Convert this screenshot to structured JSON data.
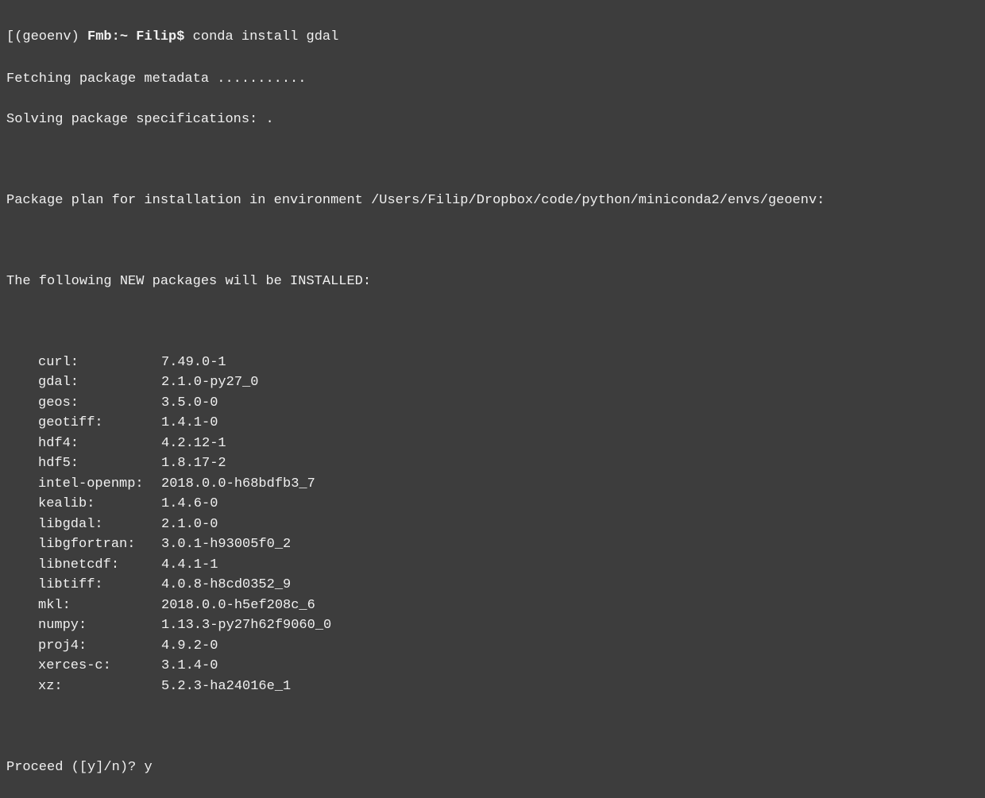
{
  "prompt": {
    "env": "(geoenv)",
    "host": "Fmb:",
    "path": "~",
    "user": "Filip$",
    "command": "conda install gdal"
  },
  "lines": {
    "fetching": "Fetching package metadata ...........",
    "solving": "Solving package specifications: .",
    "plan": "Package plan for installation in environment /Users/Filip/Dropbox/code/python/miniconda2/envs/geoenv:",
    "new_header": "The following NEW packages will be INSTALLED:",
    "proceed_prompt": "Proceed ([y]/n)?",
    "proceed_answer": "y"
  },
  "packages": [
    {
      "name": "curl:",
      "version": "7.49.0-1"
    },
    {
      "name": "gdal:",
      "version": "2.1.0-py27_0"
    },
    {
      "name": "geos:",
      "version": "3.5.0-0"
    },
    {
      "name": "geotiff:",
      "version": "1.4.1-0"
    },
    {
      "name": "hdf4:",
      "version": "4.2.12-1"
    },
    {
      "name": "hdf5:",
      "version": "1.8.17-2"
    },
    {
      "name": "intel-openmp:",
      "version": "2018.0.0-h68bdfb3_7"
    },
    {
      "name": "kealib:",
      "version": "1.4.6-0"
    },
    {
      "name": "libgdal:",
      "version": "2.1.0-0"
    },
    {
      "name": "libgfortran:",
      "version": "3.0.1-h93005f0_2"
    },
    {
      "name": "libnetcdf:",
      "version": "4.4.1-1"
    },
    {
      "name": "libtiff:",
      "version": "4.0.8-h8cd0352_9"
    },
    {
      "name": "mkl:",
      "version": "2018.0.0-h5ef208c_6"
    },
    {
      "name": "numpy:",
      "version": "1.13.3-py27h62f9060_0"
    },
    {
      "name": "proj4:",
      "version": "4.9.2-0"
    },
    {
      "name": "xerces-c:",
      "version": "3.1.4-0"
    },
    {
      "name": "xz:",
      "version": "5.2.3-ha24016e_1"
    }
  ]
}
